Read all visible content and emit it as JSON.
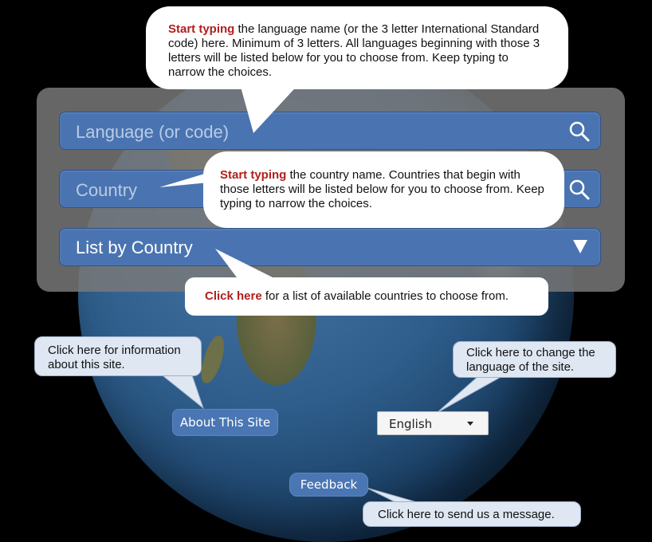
{
  "search": {
    "language_placeholder": "Language (or code)",
    "country_placeholder": "Country",
    "list_by_country": "List by Country"
  },
  "tips": {
    "language": {
      "bold": "Start typing",
      "text": " the language name (or the 3 letter International Standard code) here. Minimum of 3 letters. All languages beginning with those 3 letters will be listed below for you to choose from. Keep typing to narrow the choices."
    },
    "country": {
      "bold": "Start typing",
      "text": " the country name. Countries that begin with those letters will be listed below for you to choose from. Keep typing to narrow the choices."
    },
    "list": {
      "bold": "Click here",
      "text": " for a list of available countries to choose from."
    },
    "about": "Click here for information about this site.",
    "site_language": "Click here to change the language of the site.",
    "feedback": "Click here to send us a message."
  },
  "buttons": {
    "about": "About This Site",
    "feedback": "Feedback"
  },
  "language_select": {
    "selected": "English"
  },
  "colors": {
    "field_blue": "#4a74b1",
    "highlight_red": "#b0201c"
  },
  "icons": [
    "search-icon",
    "dropdown-triangle-icon",
    "caret-down-icon"
  ]
}
